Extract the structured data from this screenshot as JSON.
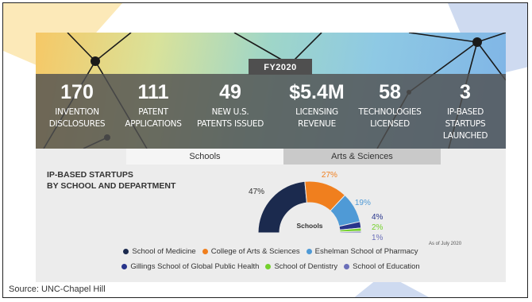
{
  "header": {
    "fy_label": "FY2020"
  },
  "stats": [
    {
      "value": "170",
      "label_line1": "INVENTION",
      "label_line2": "DISCLOSURES"
    },
    {
      "value": "111",
      "label_line1": "PATENT",
      "label_line2": "APPLICATIONS"
    },
    {
      "value": "49",
      "label_line1": "NEW U.S.",
      "label_line2": "PATENTS ISSUED"
    },
    {
      "value": "$5.4M",
      "label_line1": "LICENSING",
      "label_line2": "REVENUE"
    },
    {
      "value": "58",
      "label_line1": "TECHNOLOGIES",
      "label_line2": "LICENSED"
    },
    {
      "value": "3",
      "label_line1": "IP-BASED",
      "label_line2": "STARTUPS LAUNCHED"
    }
  ],
  "tabs": [
    {
      "label": "Schools"
    },
    {
      "label": "Arts & Sciences"
    }
  ],
  "panel": {
    "title_line1": "IP-BASED STARTUPS",
    "title_line2": "BY SCHOOL AND DEPARTMENT",
    "as_of": "As of July 2020"
  },
  "chart_data": {
    "type": "pie",
    "variant": "half-donut",
    "title": "Schools",
    "slices": [
      {
        "label": "School of Medicine",
        "value": 47,
        "value_label": "47%",
        "color": "#1b2a4e"
      },
      {
        "label": "College of Arts & Sciences",
        "value": 27,
        "value_label": "27%",
        "color": "#f07f1e"
      },
      {
        "label": "Eshelman School of Pharmacy",
        "value": 19,
        "value_label": "19%",
        "color": "#4f9ad6"
      },
      {
        "label": "Gillings School of Global Public Health",
        "value": 4,
        "value_label": "4%",
        "color": "#27348b"
      },
      {
        "label": "School of Dentistry",
        "value": 2,
        "value_label": "2%",
        "color": "#74d12c"
      },
      {
        "label": "School of Education",
        "value": 1,
        "value_label": "1%",
        "color": "#6b6fb9"
      }
    ]
  },
  "legend_rows": [
    [
      "School of Medicine",
      "College of Arts & Sciences",
      "Eshelman School of Pharmacy"
    ],
    [
      "Gillings School of Global Public Health",
      "School of Dentistry",
      "School of Education"
    ]
  ],
  "colors": {
    "banner_bar": "#505050",
    "panel_bg": "#ececec",
    "tab_inactive": "#c9c9c9"
  },
  "source": "Source: UNC-Chapel Hill"
}
